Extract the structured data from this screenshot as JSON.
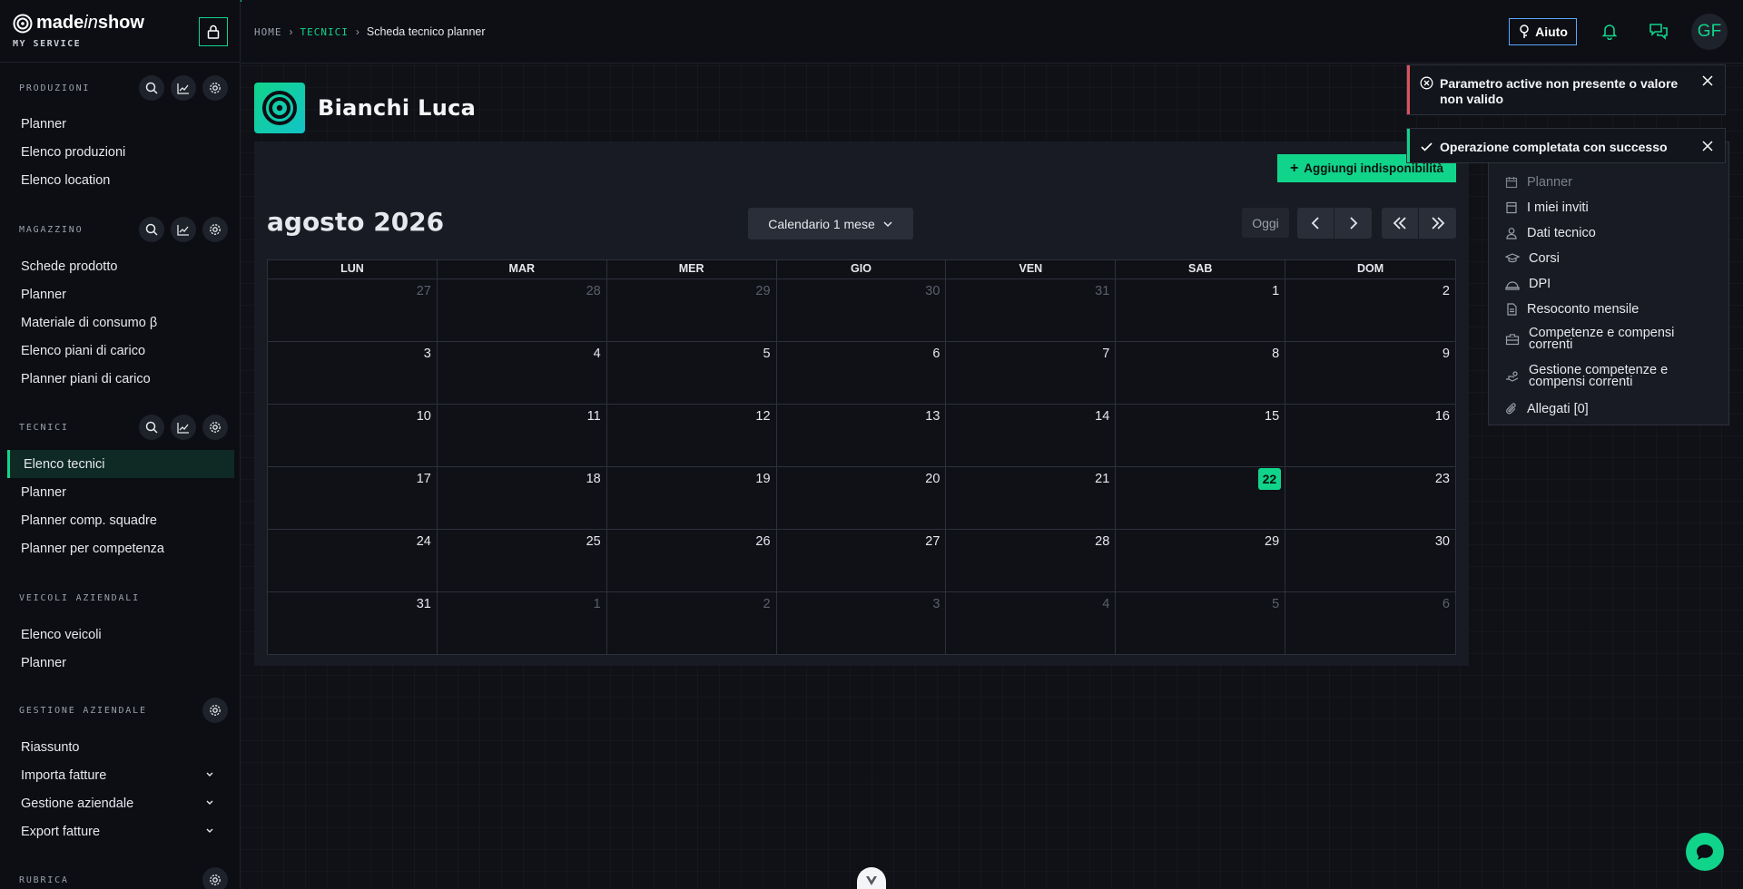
{
  "brand": {
    "name_a": "made",
    "name_b": "in",
    "name_c": "show",
    "subtitle": "MY SERVICE"
  },
  "sidebar": {
    "produzioni": {
      "title": "PRODUZIONI",
      "items": [
        "Planner",
        "Elenco produzioni",
        "Elenco location"
      ]
    },
    "magazzino": {
      "title": "MAGAZZINO",
      "items": [
        "Schede prodotto",
        "Planner",
        "Materiale di consumo β",
        "Elenco piani di carico",
        "Planner piani di carico"
      ]
    },
    "tecnici": {
      "title": "TECNICI",
      "items": [
        "Elenco tecnici",
        "Planner",
        "Planner comp. squadre",
        "Planner per competenza"
      ]
    },
    "veicoli": {
      "title": "VEICOLI AZIENDALI",
      "items": [
        "Elenco veicoli",
        "Planner"
      ]
    },
    "gestione": {
      "title": "GESTIONE AZIENDALE",
      "items": [
        "Riassunto",
        "Importa fatture",
        "Gestione aziendale",
        "Export fatture"
      ]
    },
    "rubrica": {
      "title": "RUBRICA"
    }
  },
  "header": {
    "breadcrumb": {
      "home": "HOME",
      "section": "TECNICI",
      "current": "Scheda tecnico planner"
    },
    "help_label": "Aiuto",
    "avatar_initials": "GF"
  },
  "profile": {
    "name": "Bianchi Luca"
  },
  "calendar": {
    "add_label": "Aggiungi indisponibilità",
    "month_title": "agosto 2026",
    "view_label": "Calendario 1 mese",
    "today_label": "Oggi",
    "weekdays": [
      "LUN",
      "MAR",
      "MER",
      "GIO",
      "VEN",
      "SAB",
      "DOM"
    ],
    "days": [
      [
        "27",
        "28",
        "29",
        "30",
        "31",
        "1",
        "2"
      ],
      [
        "3",
        "4",
        "5",
        "6",
        "7",
        "8",
        "9"
      ],
      [
        "10",
        "11",
        "12",
        "13",
        "14",
        "15",
        "16"
      ],
      [
        "17",
        "18",
        "19",
        "20",
        "21",
        "22",
        "23"
      ],
      [
        "24",
        "25",
        "26",
        "27",
        "28",
        "29",
        "30"
      ],
      [
        "31",
        "1",
        "2",
        "3",
        "4",
        "5",
        "6"
      ]
    ],
    "today": "22"
  },
  "side_menu": {
    "items": [
      "Planner",
      "I miei inviti",
      "Dati tecnico",
      "Corsi",
      "DPI",
      "Resoconto mensile",
      "Competenze e compensi correnti",
      "Gestione competenze e compensi correnti",
      "Allegati [0]"
    ]
  },
  "toasts": [
    {
      "text": "Parametro active non presente o valore non valido",
      "type": "error"
    },
    {
      "text": "Operazione completata con successo",
      "type": "success"
    }
  ],
  "colors": {
    "accent": "#11d48b",
    "error": "#e0505a",
    "background": "#0f1117",
    "panel": "#181b23"
  }
}
